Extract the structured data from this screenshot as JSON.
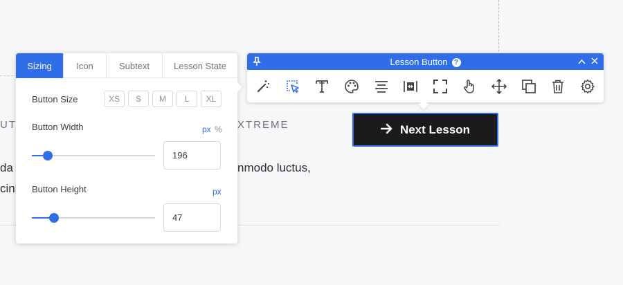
{
  "background": {
    "left_text_1": "UT",
    "extreme_text": "XTREME",
    "left_text_2": "da",
    "modo_text": "nmodo luctus,",
    "left_text_3": "cini"
  },
  "lesson_button": {
    "label": "Next Lesson",
    "arrow_icon": "arrow-right-icon"
  },
  "toolbar": {
    "title": "Lesson Button",
    "help": "?",
    "pin_icon": "pin-icon",
    "collapse_icon": "chevron-up-icon",
    "close_icon": "close-icon",
    "tools": [
      "magic-wand-icon",
      "cursor-select-icon",
      "text-icon",
      "palette-icon",
      "align-center-icon",
      "spacing-icon",
      "fullscreen-icon",
      "pointer-hand-icon",
      "move-icon",
      "duplicate-icon",
      "trash-icon",
      "gear-icon"
    ],
    "active_tool": "cursor-select-icon"
  },
  "panel": {
    "tabs": [
      {
        "label": "Sizing",
        "active": true
      },
      {
        "label": "Icon",
        "active": false
      },
      {
        "label": "Subtext",
        "active": false
      },
      {
        "label": "Lesson State",
        "active": false
      }
    ],
    "button_size": {
      "label": "Button Size",
      "options": [
        "XS",
        "S",
        "M",
        "L",
        "XL"
      ]
    },
    "button_width": {
      "label": "Button Width",
      "units": [
        "px",
        "%"
      ],
      "active_unit": "px",
      "value": "196",
      "slider_fraction": 0.13
    },
    "button_height": {
      "label": "Button Height",
      "units": [
        "px"
      ],
      "active_unit": "px",
      "value": "47",
      "slider_fraction": 0.18
    }
  },
  "colors": {
    "accent": "#2f6ee8",
    "button_bg": "#1b1b1b",
    "page_bg": "#f6f7f9"
  }
}
